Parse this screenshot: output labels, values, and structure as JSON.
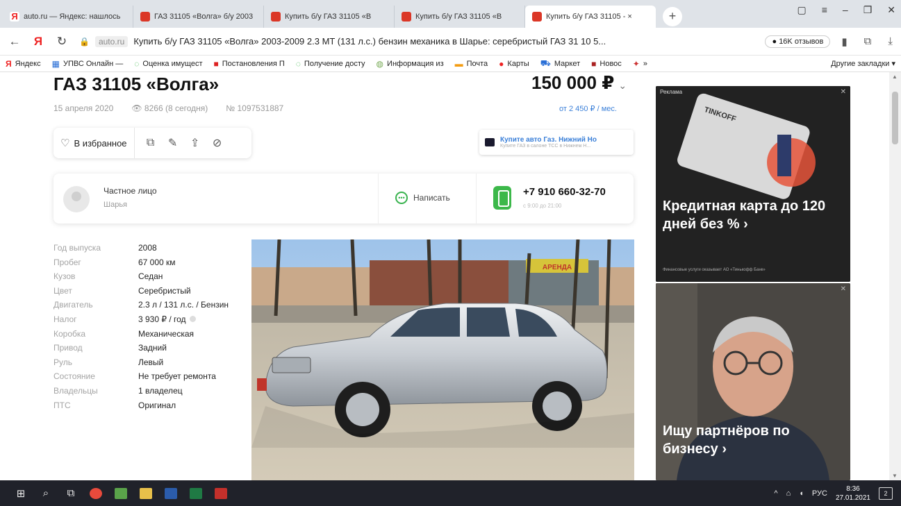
{
  "browser": {
    "tabs": [
      {
        "title": "auto.ru — Яндекс: нашлось",
        "favicon": "yandex-icon"
      },
      {
        "title": "ГАЗ 31105 «Волга» б/у 2003",
        "favicon": "autoru-icon"
      },
      {
        "title": "Купить б/у ГАЗ 31105 «В",
        "favicon": "autoru-icon"
      },
      {
        "title": "Купить б/у ГАЗ 31105 «В",
        "favicon": "autoru-icon"
      },
      {
        "title": "Купить б/у ГАЗ 31105 - ×",
        "favicon": "autoru-icon",
        "active": true
      }
    ],
    "address": {
      "domain": "auto.ru",
      "page_title": "Купить б/у ГАЗ 31105 «Волга» 2003-2009 2.3 MT (131 л.с.) бензин механика в Шарье: серебристый ГАЗ 31 10 5...",
      "reviews": "16K отзывов"
    },
    "bookmarks": [
      {
        "label": "Яндекс",
        "icon": "yandex-icon"
      },
      {
        "label": "УПВС Онлайн —",
        "icon": "upvs-icon"
      },
      {
        "label": "Оценка имущест",
        "icon": "leaf-icon"
      },
      {
        "label": "Постановления П",
        "icon": "doc-icon"
      },
      {
        "label": "Получение досту",
        "icon": "leaf-icon"
      },
      {
        "label": "Информация из",
        "icon": "globe-icon"
      },
      {
        "label": "Почта",
        "icon": "mail-icon"
      },
      {
        "label": "Карты",
        "icon": "pin-icon"
      },
      {
        "label": "Маркет",
        "icon": "cart-icon"
      },
      {
        "label": "Новос",
        "icon": "news-icon"
      },
      {
        "label": "»",
        "icon": "more-icon"
      }
    ],
    "other_bookmarks": "Другие закладки ▾"
  },
  "listing": {
    "title": "ГАЗ 31105 «Волга»",
    "price": "150 000 ₽",
    "date": "15 апреля 2020",
    "views": "8266 (8 сегодня)",
    "number": "№ 1097531887",
    "credit": "от 2 450 ₽ / мес.",
    "favorite_label": "В избранное",
    "dealer_ad": {
      "title": "Купите авто Газ. Нижний Но",
      "subtitle": "Купите ГАЗ в салоне ТСС в Нижнем Н..."
    },
    "seller": {
      "type": "Частное лицо",
      "city": "Шарья",
      "message_label": "Написать",
      "phone": "+7 910 660-32-70",
      "phone_hours": "с 9:00 до 21:00"
    },
    "specs": [
      {
        "key": "Год выпуска",
        "value": "2008"
      },
      {
        "key": "Пробег",
        "value": "67 000 км"
      },
      {
        "key": "Кузов",
        "value": "Седан"
      },
      {
        "key": "Цвет",
        "value": "Серебристый"
      },
      {
        "key": "Двигатель",
        "value": "2.3 л / 131 л.с. / Бензин"
      },
      {
        "key": "Налог",
        "value": "3 930 ₽ / год"
      },
      {
        "key": "Коробка",
        "value": "Механическая"
      },
      {
        "key": "Привод",
        "value": "Задний"
      },
      {
        "key": "Руль",
        "value": "Левый"
      },
      {
        "key": "Состояние",
        "value": "Не требует ремонта"
      },
      {
        "key": "Владельцы",
        "value": "1 владелец"
      },
      {
        "key": "ПТС",
        "value": "Оригинал"
      }
    ]
  },
  "ads": [
    {
      "label": "Реклама",
      "text": "Кредитная карта до 120 дней без % ›",
      "disclaimer": "Финансовые услуги оказывает АО «Тинькофф Банк»",
      "brand": "TINKOFF"
    },
    {
      "label": "",
      "text": "Ищу партнёров по бизнесу ›"
    }
  ],
  "photo_sign": "АРЕНДА",
  "taskbar": {
    "lang": "РУС",
    "time": "8:36",
    "date": "27.01.2021",
    "notifications": "2"
  },
  "colors": {
    "accent": "#3a7fd8",
    "green": "#3cb84a",
    "autoru_red": "#db3727"
  }
}
